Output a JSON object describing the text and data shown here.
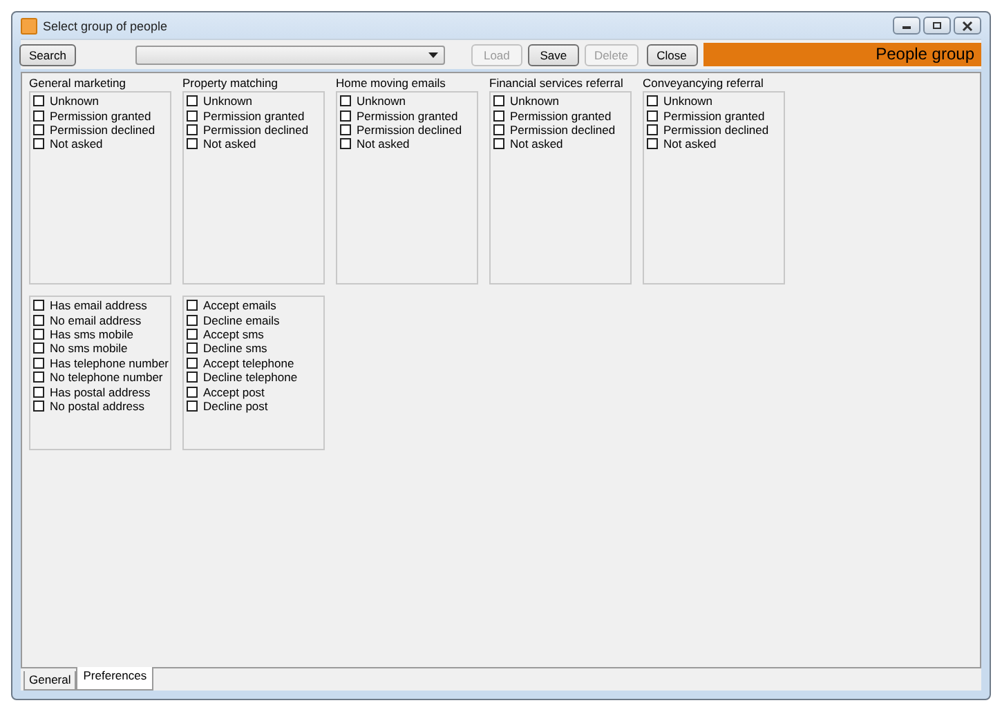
{
  "window": {
    "title": "Select group of people"
  },
  "toolbar": {
    "buttons": [
      {
        "label": "Search",
        "disabled": false
      }
    ],
    "actions": [
      {
        "label": "Load",
        "disabled": true
      },
      {
        "label": "Save",
        "disabled": false
      },
      {
        "label": "Delete",
        "disabled": true
      },
      {
        "label": "Close",
        "disabled": false
      }
    ],
    "banner": "People group"
  },
  "groups": [
    {
      "title": "General marketing",
      "options": [
        {
          "label": "Unknown",
          "checked": false
        },
        {
          "label": "Permission granted",
          "checked": false
        },
        {
          "label": "Permission declined",
          "checked": false
        },
        {
          "label": "Not asked",
          "checked": false
        }
      ]
    },
    {
      "title": "Property matching",
      "options": [
        {
          "label": "Unknown",
          "checked": false
        },
        {
          "label": "Permission granted",
          "checked": false
        },
        {
          "label": "Permission declined",
          "checked": false
        },
        {
          "label": "Not asked",
          "checked": false
        }
      ]
    },
    {
      "title": "Home moving emails",
      "options": [
        {
          "label": "Unknown",
          "checked": false
        },
        {
          "label": "Permission granted",
          "checked": false
        },
        {
          "label": "Permission declined",
          "checked": false
        },
        {
          "label": "Not asked",
          "checked": false
        }
      ]
    },
    {
      "title": "Financial services referral",
      "options": [
        {
          "label": "Unknown",
          "checked": false
        },
        {
          "label": "Permission granted",
          "checked": false
        },
        {
          "label": "Permission declined",
          "checked": false
        },
        {
          "label": "Not asked",
          "checked": false
        }
      ]
    },
    {
      "title": "Conveyancying referral",
      "options": [
        {
          "label": "Unknown",
          "checked": false
        },
        {
          "label": "Permission granted",
          "checked": false
        },
        {
          "label": "Permission declined",
          "checked": false
        },
        {
          "label": "Not asked",
          "checked": false
        }
      ]
    }
  ],
  "lists": [
    {
      "options": [
        {
          "label": "Has email address",
          "checked": false
        },
        {
          "label": "No email address",
          "checked": false
        },
        {
          "label": "Has sms mobile",
          "checked": false
        },
        {
          "label": "No sms mobile",
          "checked": false
        },
        {
          "label": "Has telephone number",
          "checked": false
        },
        {
          "label": "No telephone number",
          "checked": false
        },
        {
          "label": "Has postal address",
          "checked": false
        },
        {
          "label": "No postal address",
          "checked": false
        }
      ]
    },
    {
      "options": [
        {
          "label": "Accept emails",
          "checked": false
        },
        {
          "label": "Decline emails",
          "checked": false
        },
        {
          "label": "Accept sms",
          "checked": false
        },
        {
          "label": "Decline sms",
          "checked": false
        },
        {
          "label": "Accept telephone",
          "checked": false
        },
        {
          "label": "Decline telephone",
          "checked": false
        },
        {
          "label": "Accept post",
          "checked": false
        },
        {
          "label": "Decline post",
          "checked": false
        }
      ]
    }
  ],
  "tabs": [
    {
      "label": "General",
      "selected": false
    },
    {
      "label": "Preferences",
      "selected": true
    }
  ]
}
